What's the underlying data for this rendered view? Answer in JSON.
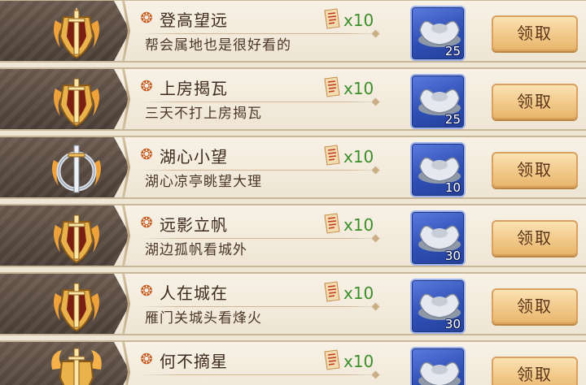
{
  "tasks": [
    {
      "title": "登高望远",
      "desc": "帮会属地也是很好看的",
      "points": "x10",
      "reward_qty": "25",
      "claim_label": "领取",
      "badge": "gold-shield-sword-emblem"
    },
    {
      "title": "上房揭瓦",
      "desc": "三天不打上房揭瓦",
      "points": "x10",
      "reward_qty": "25",
      "claim_label": "领取",
      "badge": "gold-shield-sword-emblem"
    },
    {
      "title": "湖心小望",
      "desc": "湖心凉亭眺望大理",
      "points": "x10",
      "reward_qty": "10",
      "claim_label": "领取",
      "badge": "silver-ring-sword-emblem"
    },
    {
      "title": "远影立帆",
      "desc": "湖边孤帆看城外",
      "points": "x10",
      "reward_qty": "30",
      "claim_label": "领取",
      "badge": "gold-shield-sword-emblem"
    },
    {
      "title": "人在城在",
      "desc": "雁门关城头看烽火",
      "points": "x10",
      "reward_qty": "30",
      "claim_label": "领取",
      "badge": "gold-shield-sword-emblem"
    },
    {
      "title": "何不摘星",
      "desc": "",
      "points": "x10",
      "reward_qty": "",
      "claim_label": "领取",
      "badge": "gold-flame-sword-emblem"
    }
  ],
  "icons": {
    "task": "flame-swirl-icon",
    "points": "scroll-point-icon",
    "reward": "silver-ingot-icon"
  },
  "colors": {
    "points_text": "#3b8f2b",
    "reward_bg": "#2f4fb5",
    "claim_bg": "#f2c98a",
    "badge_panel": "#4b3e36"
  }
}
